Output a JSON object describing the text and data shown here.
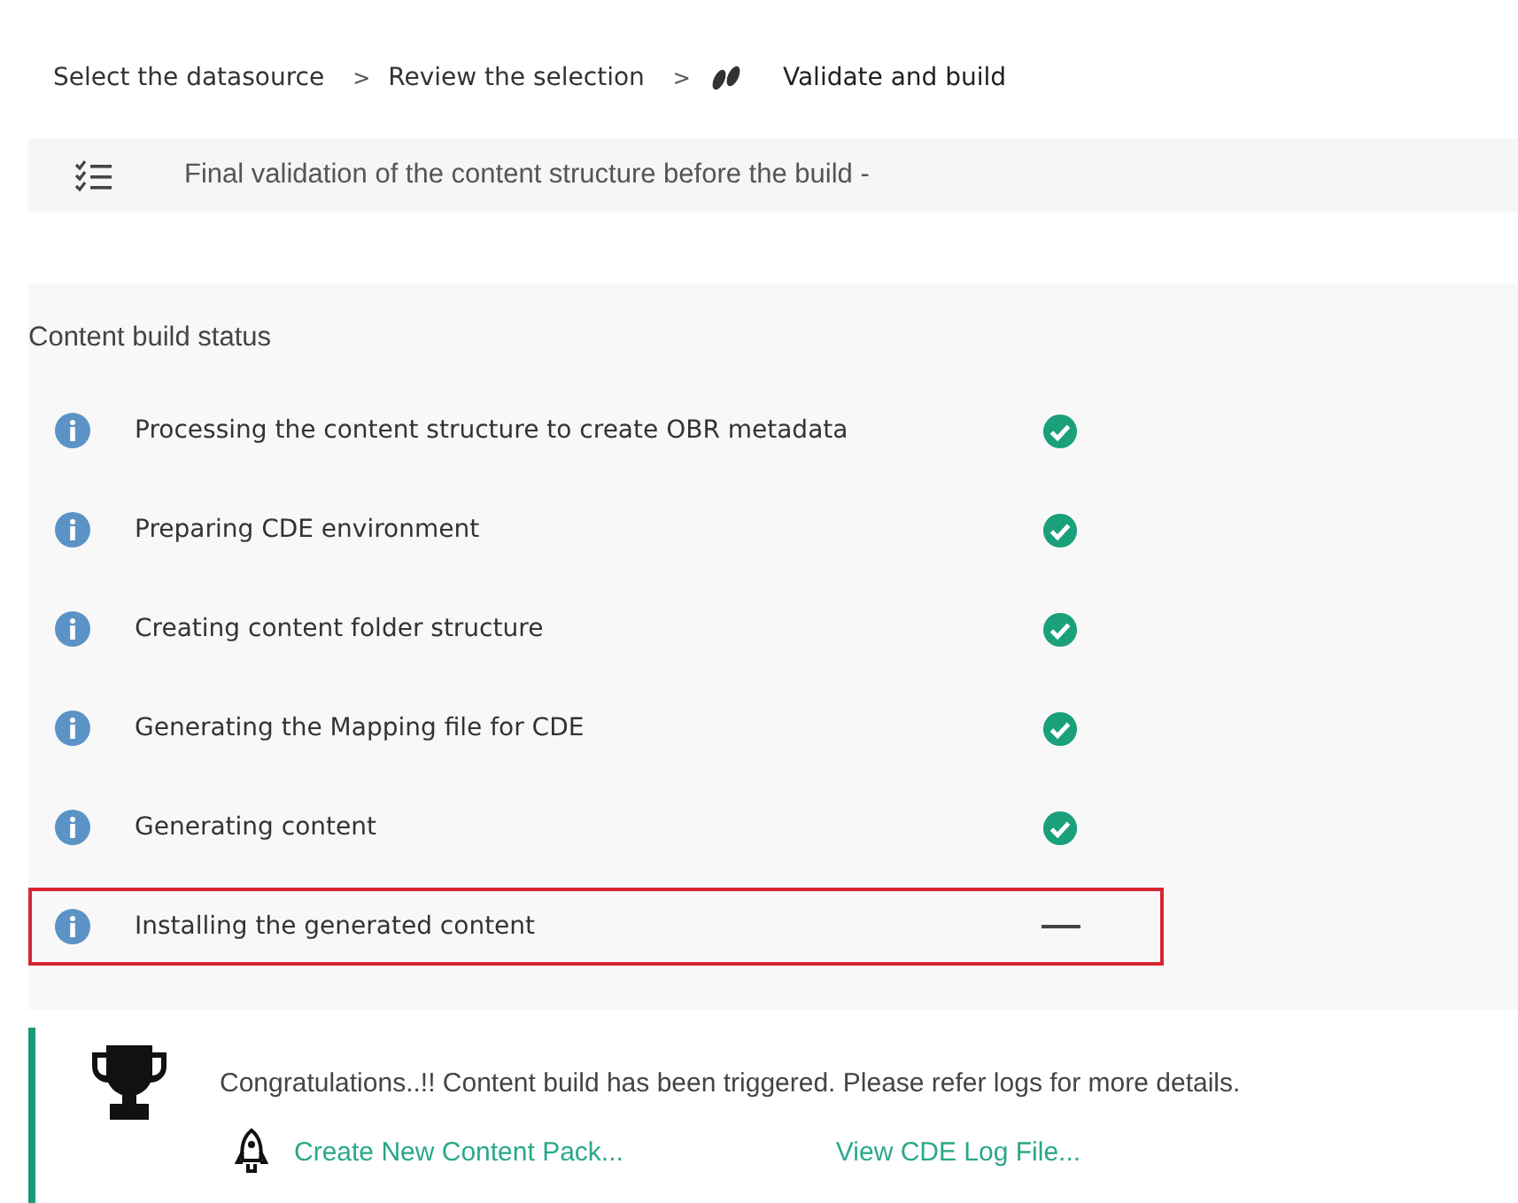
{
  "breadcrumb": [
    {
      "label": "Select the datasource",
      "current": false
    },
    {
      "label": "Review the selection",
      "current": false
    },
    {
      "label": "Validate and build",
      "current": true
    }
  ],
  "breadcrumb_separator": ">",
  "validation_bar": {
    "text": "Final validation of the content structure before the build -"
  },
  "build_status": {
    "title": "Content build status",
    "steps": [
      {
        "label": "Processing the content structure to create OBR metadata",
        "completed": true,
        "highlighted": false
      },
      {
        "label": "Preparing CDE environment",
        "completed": true,
        "highlighted": false
      },
      {
        "label": "Creating content folder structure",
        "completed": true,
        "highlighted": false
      },
      {
        "label": "Generating the Mapping file for CDE",
        "completed": true,
        "highlighted": false
      },
      {
        "label": "Generating content",
        "completed": true,
        "highlighted": false
      },
      {
        "label": "Installing the generated content",
        "completed": false,
        "highlighted": true
      }
    ]
  },
  "banner": {
    "message": "Congratulations..!! Content build has been triggered. Please refer logs for more details.",
    "links": [
      "Create New Content Pack...",
      "View CDE Log File..."
    ]
  }
}
